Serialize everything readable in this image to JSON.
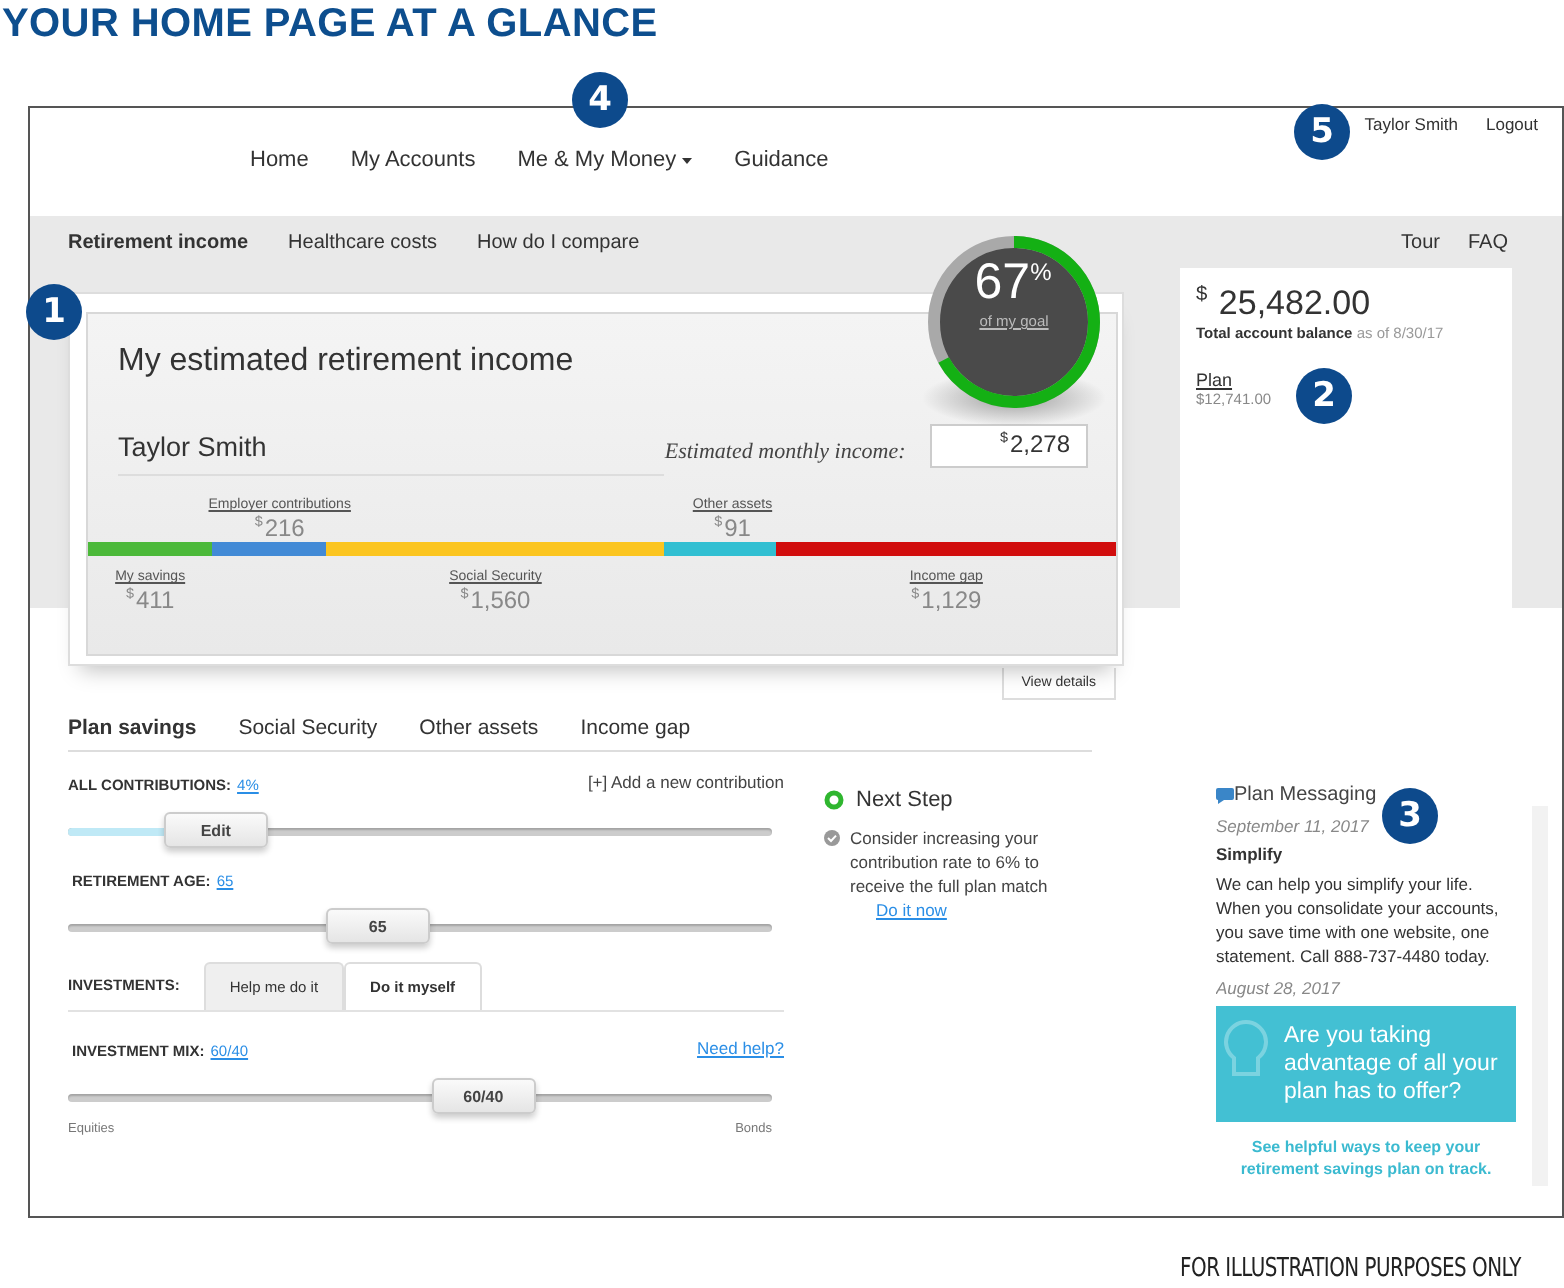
{
  "heading": "YOUR HOME PAGE AT A GLANCE",
  "nav": {
    "items": [
      {
        "label": "Home",
        "dropdown": false
      },
      {
        "label": "My Accounts",
        "dropdown": false
      },
      {
        "label": "Me & My Money",
        "dropdown": true
      },
      {
        "label": "Guidance",
        "dropdown": false
      }
    ],
    "user": "Taylor Smith",
    "logout": "Logout"
  },
  "subnav": {
    "items": [
      {
        "label": "Retirement income",
        "selected": true
      },
      {
        "label": "Healthcare costs",
        "selected": false
      },
      {
        "label": "How do I compare",
        "selected": false
      }
    ],
    "links": [
      "Tour",
      "FAQ"
    ]
  },
  "income_card": {
    "title": "My estimated retirement income",
    "name": "Taylor Smith",
    "monthly_label": "Estimated monthly income:",
    "monthly_currency": "$",
    "monthly_value": "2,278",
    "goal": {
      "percent": "67",
      "unit": "%",
      "caption": "of my goal",
      "level": 0.67
    },
    "segments": [
      {
        "kind": "lower",
        "label": "My savings",
        "currency": "$",
        "amount": "411",
        "color": "#4cb93a"
      },
      {
        "kind": "upper",
        "label": "Employer contributions",
        "currency": "$",
        "amount": "216",
        "color": "#428ad6"
      },
      {
        "kind": "lower",
        "label": "Social Security",
        "currency": "$",
        "amount": "1,560",
        "color": "#fbc520"
      },
      {
        "kind": "upper",
        "label": "Other assets",
        "currency": "$",
        "amount": "91",
        "color": "#31bfd2"
      },
      {
        "kind": "lower",
        "label": "Income gap",
        "currency": "$",
        "amount": "1,129",
        "color": "#d10d0d"
      }
    ],
    "view_details": "View details"
  },
  "balance": {
    "currency": "$",
    "amount": "25,482.00",
    "label": "Total account balance",
    "as_of": "as of 8/30/17",
    "plan": "Plan",
    "plan_amount": "$12,741.00"
  },
  "plan_tabs": [
    {
      "label": "Plan savings",
      "selected": true
    },
    {
      "label": "Social Security",
      "selected": false
    },
    {
      "label": "Other assets",
      "selected": false
    },
    {
      "label": "Income gap",
      "selected": false
    }
  ],
  "contributions": {
    "label": "ALL CONTRIBUTIONS:",
    "value": "4%",
    "add": "[+] Add a new contribution",
    "slider": {
      "thumb": "Edit",
      "level": 0.21,
      "highlighted": true
    }
  },
  "retirement_age": {
    "label": "RETIREMENT AGE:",
    "value": "65",
    "slider": {
      "thumb": "65",
      "level": 0.44,
      "highlighted": false
    }
  },
  "investments": {
    "label": "INVESTMENTS:",
    "tabs": [
      {
        "label": "Help me do it",
        "selected": false
      },
      {
        "label": "Do it myself",
        "selected": true
      }
    ]
  },
  "investment_mix": {
    "label": "INVESTMENT MIX:",
    "value": "60/40",
    "help": "Need help?",
    "slider": {
      "thumb": "60/40",
      "level": 0.59,
      "highlighted": false
    },
    "left": "Equities",
    "right": "Bonds"
  },
  "next_step": {
    "title": "Next Step",
    "text": "Consider increasing your contribution rate to 6% to receive the full plan match",
    "action": "Do it now"
  },
  "messaging": {
    "title": "Plan Messaging",
    "messages": [
      {
        "kind": "text",
        "date": "September 11, 2017",
        "title": "Simplify",
        "body": "We can help you simplify your life. When you consolidate your accounts, you save time with one website, one statement. Call 888-737-4480 today."
      },
      {
        "kind": "promo",
        "date": "August 28, 2017",
        "headline": "Are you taking advantage of all your plan has to offer?",
        "link": "See helpful ways to keep your retirement savings plan on track."
      }
    ]
  },
  "callouts": [
    "1",
    "2",
    "3",
    "4",
    "5"
  ],
  "footer": "FOR ILLUSTRATION PURPOSES ONLY"
}
